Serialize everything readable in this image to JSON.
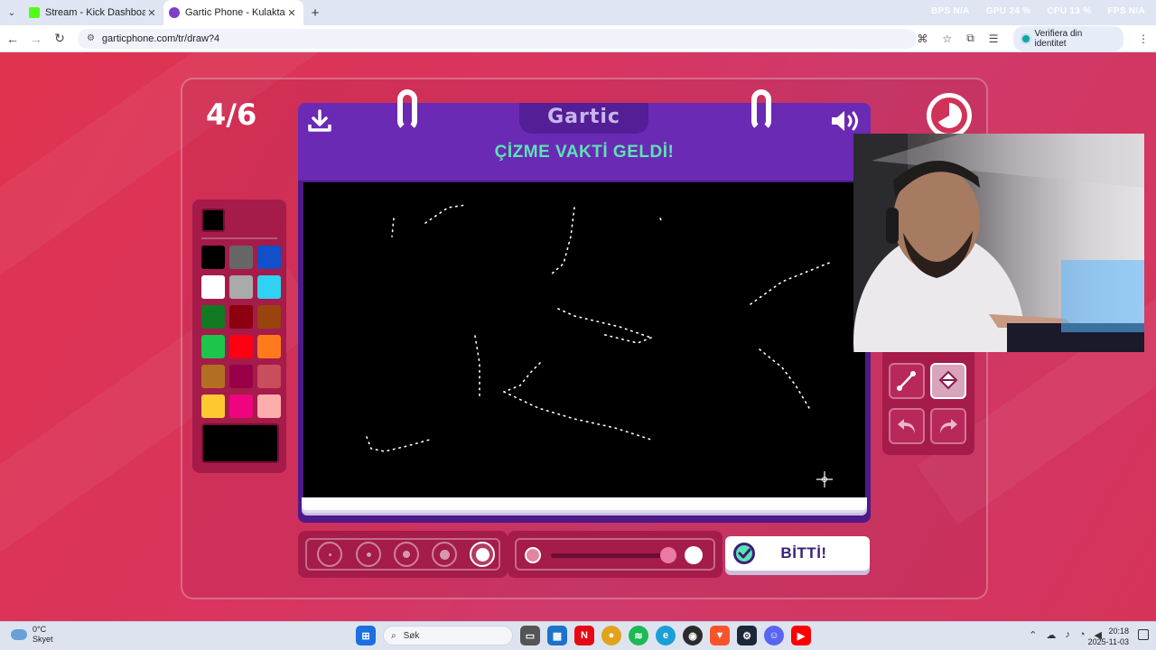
{
  "browser": {
    "tabs": [
      {
        "title": "Stream - Kick Dashboard",
        "favicon_color": "#53fc18",
        "active": false
      },
      {
        "title": "Gartic Phone - Kulaktan Kulağa",
        "favicon_color": "#7b3fc6",
        "active": true
      }
    ],
    "overlay_stats": [
      "BPS N/A",
      "GPU 24 %",
      "CPU 13 %",
      "FPS N/A"
    ],
    "url": "garticphone.com/tr/draw?4",
    "verify_label": "Verifiera din identitet"
  },
  "game": {
    "round": "4/6",
    "brand": "Gartic",
    "prompt": "ÇİZME VAKTİ GELDİ!",
    "done_label": "BİTTİ!",
    "selected_color": "#000000",
    "palette": [
      "#000000",
      "#666666",
      "#1050c8",
      "#ffffff",
      "#aaaaaa",
      "#30d2f2",
      "#137a24",
      "#8c0010",
      "#99430e",
      "#1dc64a",
      "#ff0013",
      "#ff7a1c",
      "#b26f22",
      "#990048",
      "#c84e5e",
      "#fec830",
      "#ef0480",
      "#fdadac"
    ],
    "brush_sizes_selected_index": 4,
    "opacity_level": 1.0,
    "tools": [
      "line-tool",
      "fill-tool",
      "undo",
      "redo"
    ],
    "selected_tool": "fill-tool"
  },
  "taskbar": {
    "weather_temp": "0°C",
    "weather_desc": "Skyet",
    "search_placeholder": "Søk",
    "time": "20:18",
    "date": "2025-11-03"
  }
}
